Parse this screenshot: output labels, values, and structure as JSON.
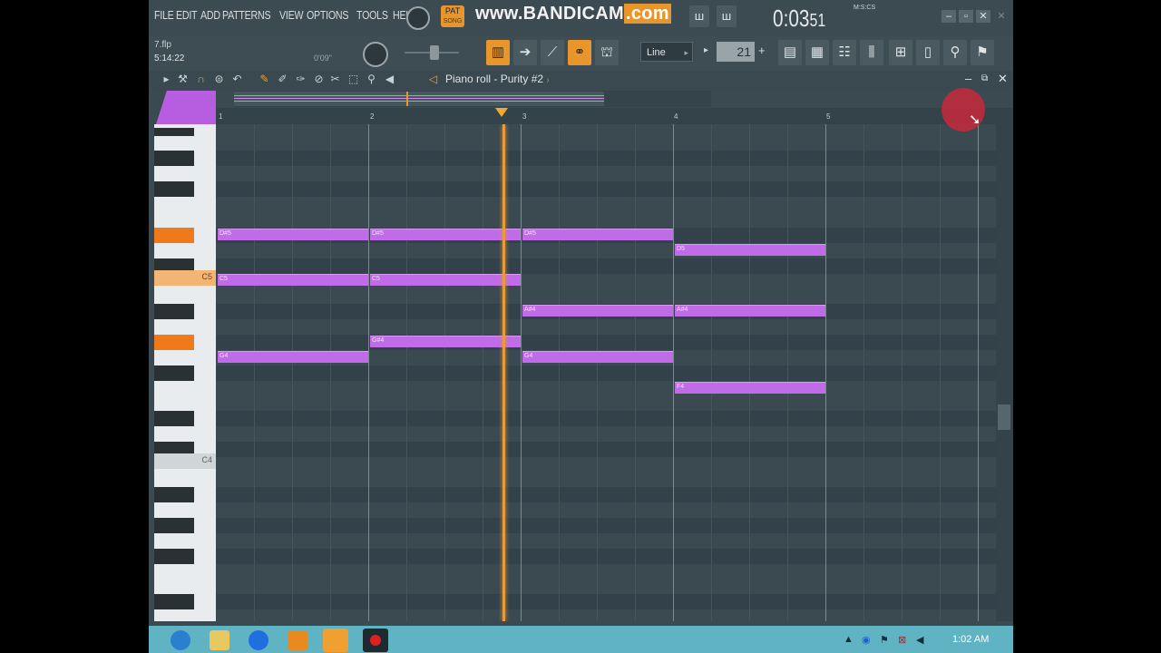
{
  "menu": [
    "FILE",
    "EDIT",
    "ADD",
    "PATTERNS",
    "VIEW",
    "OPTIONS",
    "TOOLS",
    "HELP"
  ],
  "pat_label": "PAT",
  "song_label": "SONG",
  "watermark": {
    "www": "www.BANDI",
    "cam": "CAM",
    "com": ".com"
  },
  "transport": {
    "time": "0:03",
    "time_small": "51",
    "time_label": "M:S:CS"
  },
  "hint": {
    "file": "7.flp",
    "position": "5:14:22",
    "cpu": "0'09\""
  },
  "snap": {
    "value": "Line"
  },
  "tempo": {
    "value": "21"
  },
  "piano_roll": {
    "title": "Piano roll - Purity #2",
    "ruler": [
      "1",
      "2",
      "3",
      "4",
      "5"
    ],
    "keys": {
      "c5": "C5",
      "c4": "C4"
    },
    "notes": [
      {
        "label": "D#5"
      },
      {
        "label": "D#5"
      },
      {
        "label": "D#5"
      },
      {
        "label": "D5"
      },
      {
        "label": "C5"
      },
      {
        "label": "C5"
      },
      {
        "label": "A#4"
      },
      {
        "label": "A#4"
      },
      {
        "label": "G#4"
      },
      {
        "label": "G4"
      },
      {
        "label": "G4"
      },
      {
        "label": "F4"
      }
    ]
  },
  "taskbar": {
    "clock": "1:02 AM"
  },
  "colors": {
    "note": "#c06be8",
    "accent": "#e8962c",
    "playhead": "#e89b3c",
    "taskbar": "#5fb3c2"
  }
}
